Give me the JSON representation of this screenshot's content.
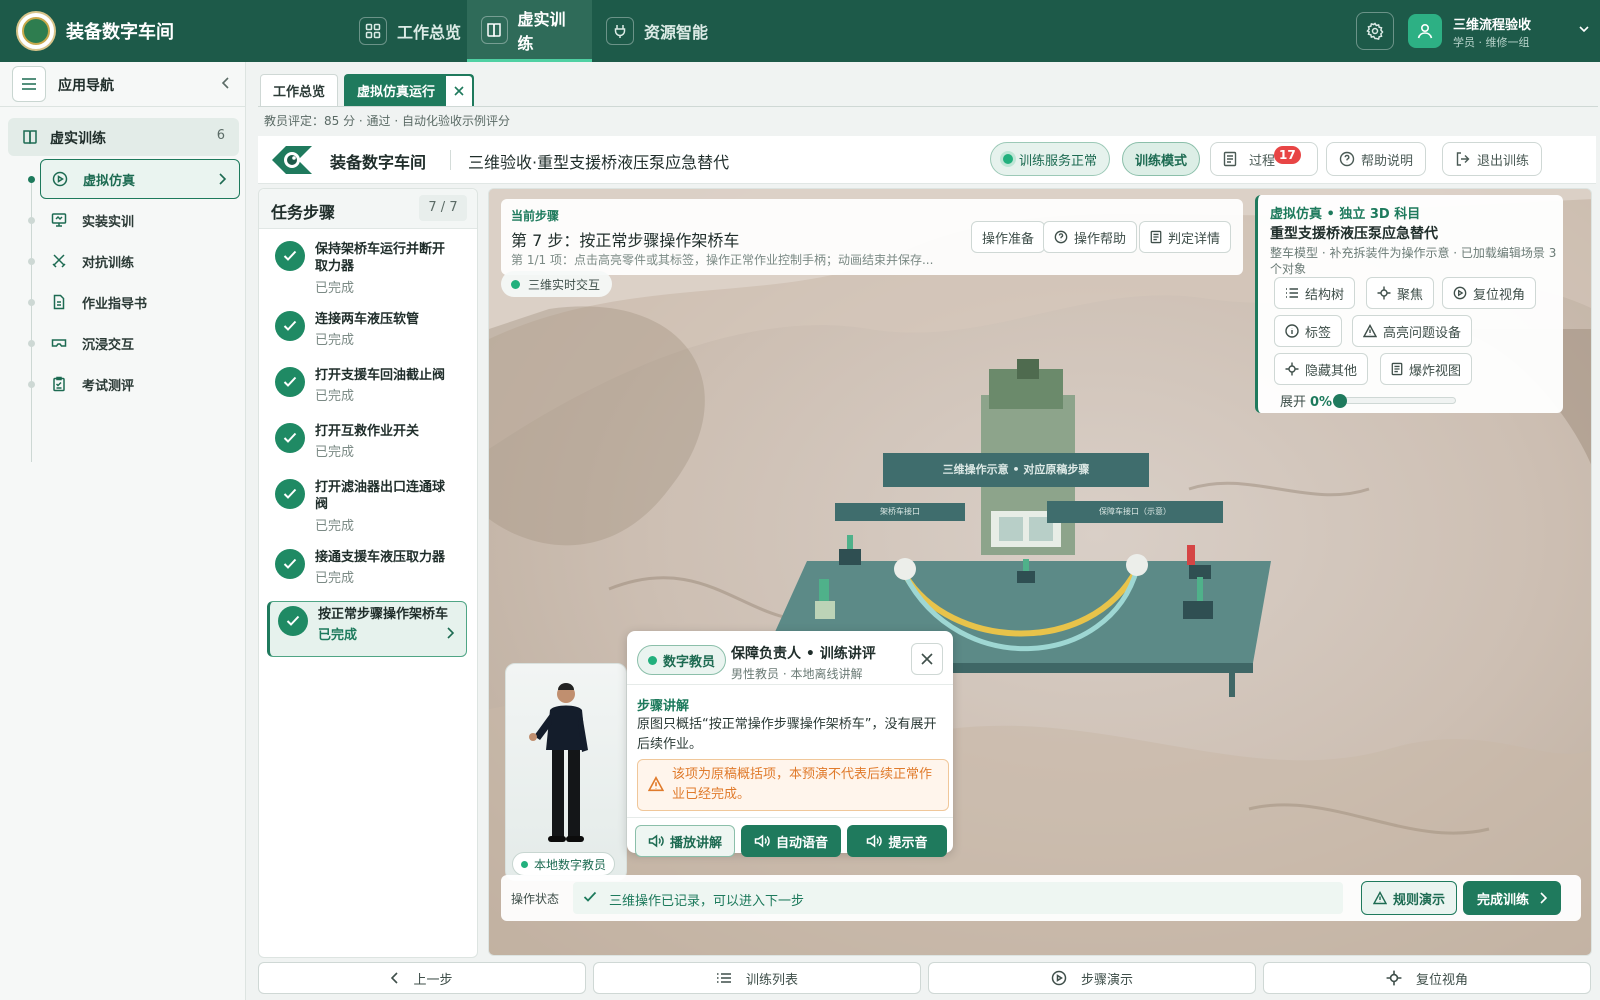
{
  "app": {
    "title": "装备数字车间"
  },
  "topnav": [
    {
      "label": "工作总览",
      "icon": "grid-icon"
    },
    {
      "label": "虚实训练",
      "icon": "book-icon",
      "active": true
    },
    {
      "label": "资源智能",
      "icon": "plug-icon"
    }
  ],
  "user": {
    "name": "三维流程验收",
    "role": "学员 · 维修一组"
  },
  "sidebar": {
    "title": "应用导航",
    "group": {
      "label": "虚实训练",
      "count": "6"
    },
    "items": [
      {
        "label": "虚拟仿真",
        "icon": "play-circle-icon",
        "active": true
      },
      {
        "label": "实装实训",
        "icon": "monitor-icon"
      },
      {
        "label": "对抗训练",
        "icon": "swords-icon"
      },
      {
        "label": "作业指导书",
        "icon": "document-icon"
      },
      {
        "label": "沉浸交互",
        "icon": "vr-headset-icon"
      },
      {
        "label": "考试测评",
        "icon": "clipboard-icon"
      }
    ]
  },
  "tabs": [
    {
      "label": "工作总览"
    },
    {
      "label": "虚拟仿真运行",
      "active": true
    }
  ],
  "evaluation": "教员评定：85 分 · 通过 · 自动化验收示例评分",
  "header": {
    "brand": "装备数字车间",
    "title": "三维验收·重型支援桥液压泵应急替代",
    "service_status": "训练服务正常",
    "mode": "训练模式",
    "process": "过程",
    "process_badge": "17",
    "help": "帮助说明",
    "exit": "退出训练"
  },
  "steps": {
    "title": "任务步骤",
    "progress": "7 / 7",
    "items": [
      {
        "title": "保持架桥车运行并断开取力器",
        "status": "已完成"
      },
      {
        "title": "连接两车液压软管",
        "status": "已完成"
      },
      {
        "title": "打开支援车回油截止阀",
        "status": "已完成"
      },
      {
        "title": "打开互救作业开关",
        "status": "已完成"
      },
      {
        "title": "打开滤油器出口连通球阀",
        "status": "已完成"
      },
      {
        "title": "接通支援车液压取力器",
        "status": "已完成"
      },
      {
        "title": "按正常步骤操作架桥车",
        "status": "已完成",
        "active": true
      }
    ]
  },
  "current_step": {
    "label": "当前步骤",
    "title": "第 7 步：按正常步骤操作架桥车",
    "detail": "第 1/1 项：点击高亮零件或其标签，操作正常作业控制手柄；动画结束并保存...",
    "buttons": [
      "操作准备",
      "操作帮助",
      "判定详情"
    ]
  },
  "live_tag": "三维实时交互",
  "virtual_panel": {
    "label": "虚拟仿真 • 独立 3D 科目",
    "title": "重型支援桥液压泵应急替代",
    "desc": "整车模型 · 补充拆装件为操作示意 · 已加载编辑场景 3 个对象",
    "buttons": [
      "结构树",
      "聚焦",
      "复位视角",
      "标签",
      "高亮问题设备",
      "隐藏其他",
      "爆炸视图"
    ],
    "expand_label": "展开",
    "expand_value": "0%",
    "expand_fraction": 0
  },
  "scene_labels": {
    "main": "三维操作示意 • 对应原稿步骤",
    "left": "架桥车接口",
    "right": "保障车接口（示意）"
  },
  "coach": {
    "tag": "数字教员",
    "name": "保障负责人 • 训练讲评",
    "sub": "男性教员 · 本地离线讲解",
    "label": "本地数字教员",
    "explain_label": "步骤讲解",
    "explain_text": "原图只概括“按正常操作步骤操作架桥车”，没有展开后续作业。",
    "warning": "该项为原稿概括项，本预演不代表后续正常作业已经完成。",
    "buttons": [
      "播放讲解",
      "自动语音",
      "提示音"
    ]
  },
  "status": {
    "label": "操作状态",
    "text": "三维操作已记录，可以进入下一步",
    "rule_demo": "规则演示",
    "finish": "完成训练"
  },
  "bottom": [
    {
      "label": "上一步",
      "icon": "chevron-left-icon"
    },
    {
      "label": "训练列表",
      "icon": "list-icon"
    },
    {
      "label": "步骤演示",
      "icon": "play-circle-icon"
    },
    {
      "label": "复位视角",
      "icon": "crosshair-icon"
    }
  ],
  "colors": {
    "brand": "#1d5a49",
    "accent": "#1f7a5d",
    "warning": "#e07b2c",
    "badge": "#e84545"
  }
}
